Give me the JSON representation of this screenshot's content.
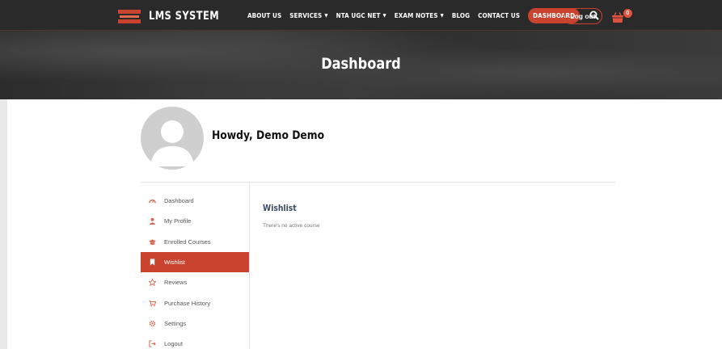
{
  "brand": {
    "name": "LMS SYSTEM"
  },
  "nav": {
    "items": [
      {
        "label": "ABOUT US",
        "has_dropdown": false
      },
      {
        "label": "SERVICES",
        "has_dropdown": true
      },
      {
        "label": "NTA UGC NET",
        "has_dropdown": true
      },
      {
        "label": "EXAM NOTES",
        "has_dropdown": true
      },
      {
        "label": "BLOG",
        "has_dropdown": false
      },
      {
        "label": "CONTACT US",
        "has_dropdown": false
      },
      {
        "label": "DASHBOARD",
        "has_dropdown": false,
        "active": true
      }
    ],
    "search_icon": "search-icon",
    "logout_label": "Log out",
    "cart_count": "0",
    "cart_icon": "cart-icon"
  },
  "hero": {
    "title": "Dashboard"
  },
  "profile": {
    "greeting": "Howdy, Demo Demo"
  },
  "sidebar": {
    "items": [
      {
        "label": "Dashboard",
        "icon": "gauge-icon"
      },
      {
        "label": "My Profile",
        "icon": "user-icon"
      },
      {
        "label": "Enrolled Courses",
        "icon": "graduation-cap-icon"
      },
      {
        "label": "Wishlist",
        "icon": "bookmark-icon",
        "active": true
      },
      {
        "label": "Reviews",
        "icon": "star-icon"
      },
      {
        "label": "Purchase History",
        "icon": "cart-icon"
      },
      {
        "label": "Settings",
        "icon": "gear-icon"
      },
      {
        "label": "Logout",
        "icon": "logout-icon"
      }
    ]
  },
  "panel": {
    "title": "Wishlist",
    "empty_message": "There's no active course"
  },
  "colors": {
    "accent": "#c9432e",
    "topbar": "#2a2a2a",
    "heading": "#3b4a63"
  }
}
